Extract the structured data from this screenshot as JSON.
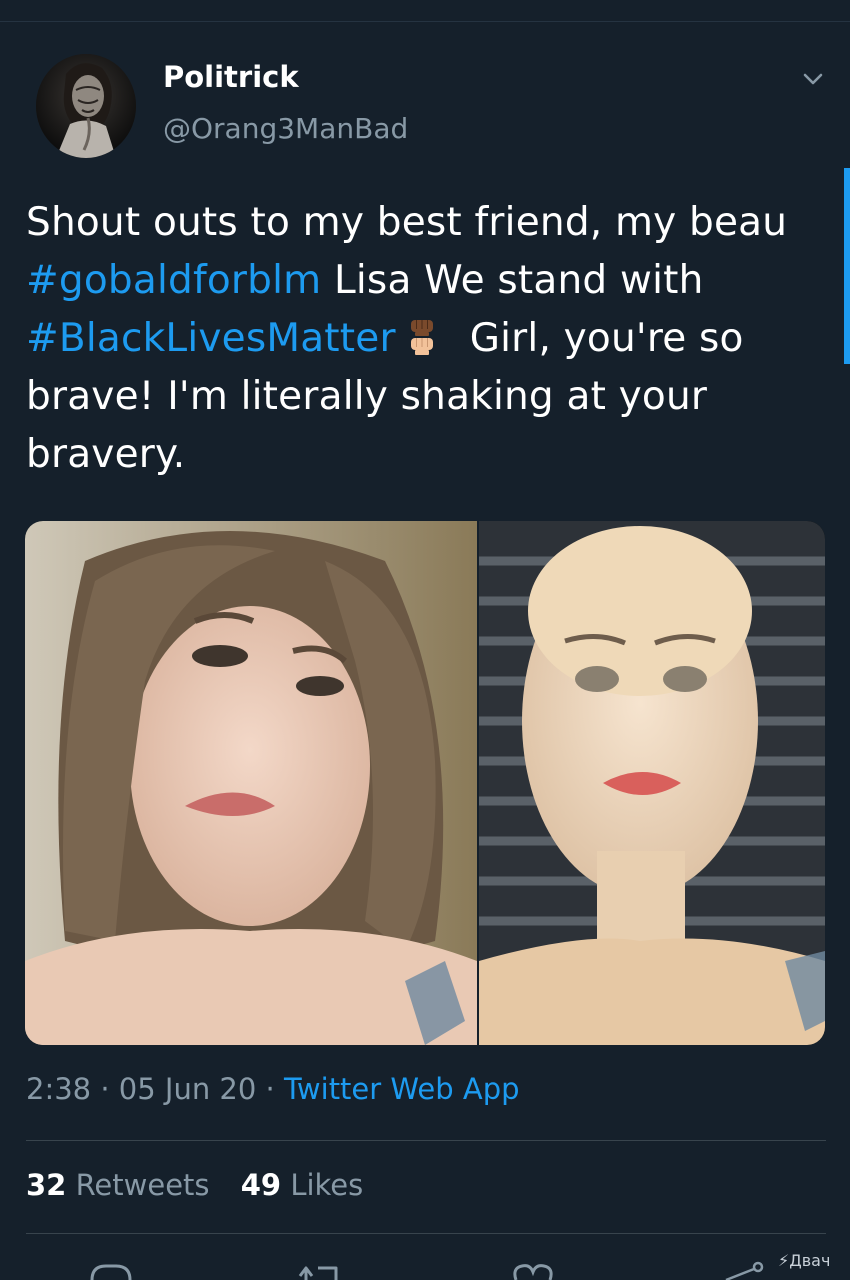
{
  "tweet": {
    "author": {
      "display_name": "Politrick",
      "handle": "@Orang3ManBad"
    },
    "text": {
      "part1": "Shout outs to my best friend, my beau ",
      "hashtag1": "#gobaldforblm",
      "part2": " Lisa We stand with ",
      "hashtag2": "#BlackLivesMatter",
      "part3": "Girl, you're so brave! I'm literally shaking at your bravery."
    },
    "meta": {
      "time": "2:38",
      "sep1": " · ",
      "date": "05 Jun 20",
      "sep2": " · ",
      "app": "Twitter Web App"
    },
    "stats": {
      "retweets_count": "32",
      "retweets_label": "Retweets",
      "likes_count": "49",
      "likes_label": "Likes"
    }
  },
  "watermark": "Двач",
  "icons": {
    "caret": "chevron-down-icon",
    "reply": "reply-icon",
    "retweet": "retweet-icon",
    "like": "heart-icon",
    "share": "share-icon",
    "emoji": "raised-fist-icon"
  },
  "colors": {
    "background": "#15202b",
    "accent": "#1d9bf0",
    "secondary_text": "#8899a6",
    "divider": "#38444d"
  }
}
